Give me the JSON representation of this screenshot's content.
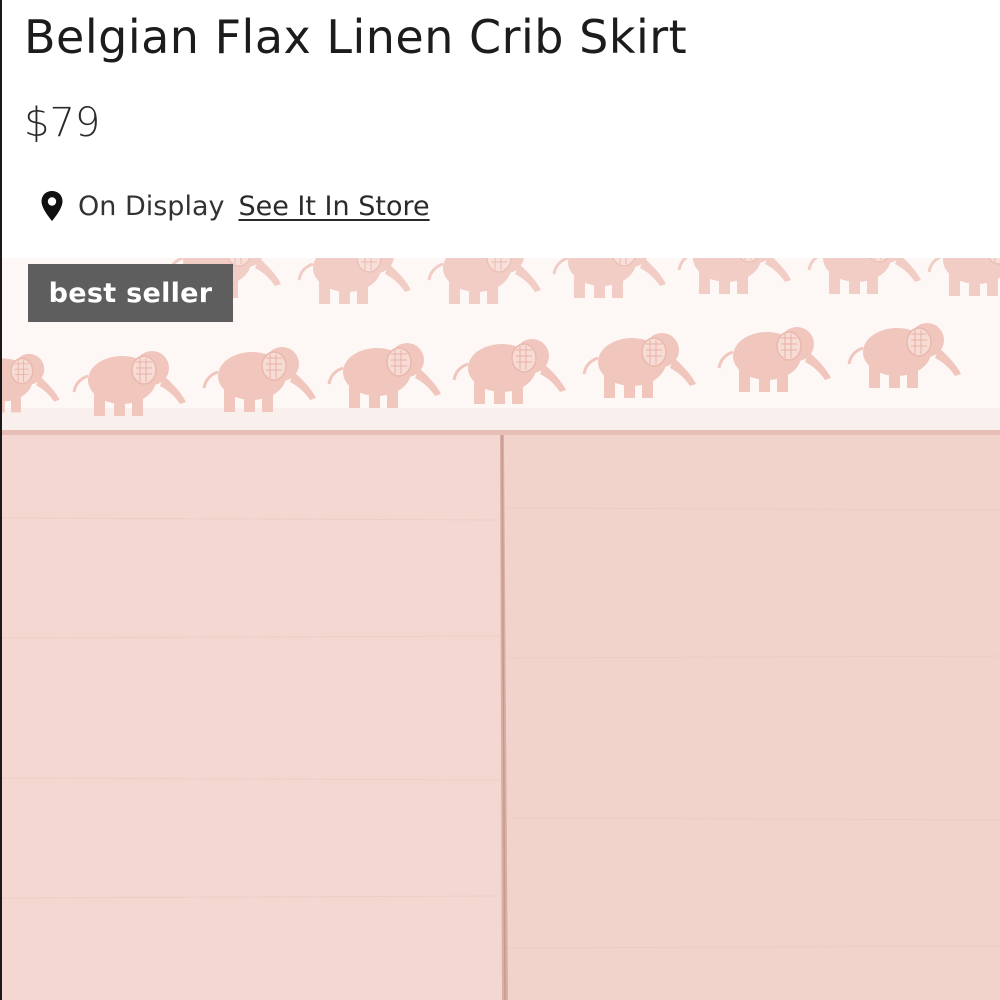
{
  "product": {
    "title": "Belgian Flax Linen Crib Skirt",
    "price": "$79",
    "availability": {
      "status": "On Display",
      "link_label": "See It In Store",
      "icon": "location-pin-icon"
    },
    "badge": "best seller"
  },
  "colors": {
    "skirt": "#f3d5cf",
    "sheet_background": "#fdf8f6",
    "elephant_print": "#f0c6bd",
    "badge_background": "#5e5e5e",
    "text": "#1c1c1c"
  }
}
